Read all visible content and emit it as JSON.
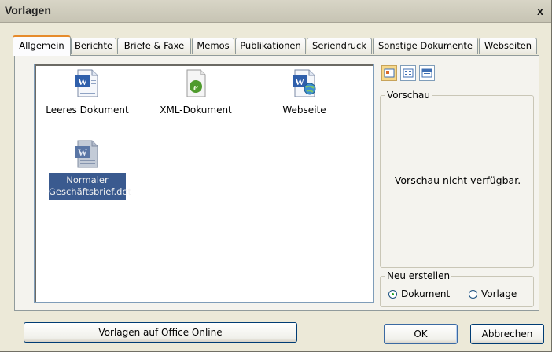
{
  "window": {
    "title": "Vorlagen",
    "close_glyph": "x"
  },
  "tabs": [
    {
      "label": "Allgemein",
      "active": true
    },
    {
      "label": "Berichte"
    },
    {
      "label": "Briefe & Faxe"
    },
    {
      "label": "Memos"
    },
    {
      "label": "Publikationen"
    },
    {
      "label": "Seriendruck"
    },
    {
      "label": "Sonstige Dokumente"
    },
    {
      "label": "Webseiten"
    }
  ],
  "templates": [
    {
      "label": "Leeres Dokument",
      "icon": "word-document-icon"
    },
    {
      "label": "XML-Dokument",
      "icon": "xml-document-icon"
    },
    {
      "label": "Webseite",
      "icon": "web-page-icon"
    },
    {
      "label_line1": "Normaler",
      "label_line2": "Geschäftsbrief.dot",
      "icon": "word-template-icon",
      "selected": true
    }
  ],
  "view_buttons": [
    "large-icons-view-icon",
    "list-view-icon",
    "details-view-icon"
  ],
  "preview": {
    "legend": "Vorschau",
    "text": "Vorschau nicht verfügbar."
  },
  "create_new": {
    "legend": "Neu erstellen",
    "options": [
      {
        "label": "Dokument",
        "checked": true
      },
      {
        "label": "Vorlage",
        "checked": false
      }
    ]
  },
  "buttons": {
    "online": "Vorlagen auf Office Online",
    "ok": "OK",
    "cancel": "Abbrechen"
  }
}
